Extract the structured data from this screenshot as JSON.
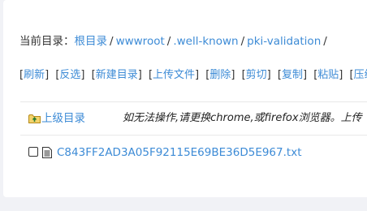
{
  "breadcrumb": {
    "label": "当前目录：",
    "items": [
      {
        "label": "根目录"
      },
      {
        "label": "wwwroot"
      },
      {
        "label": ".well-known"
      },
      {
        "label": "pki-validation"
      }
    ],
    "separator": "/"
  },
  "operations": [
    {
      "label": "刷新"
    },
    {
      "label": "反选"
    },
    {
      "label": "新建目录"
    },
    {
      "label": "上传文件"
    },
    {
      "label": "删除"
    },
    {
      "label": "剪切"
    },
    {
      "label": "复制"
    },
    {
      "label": "粘贴"
    },
    {
      "label": "压缩"
    }
  ],
  "parent_dir": {
    "label": "上级目录",
    "icon": "folder-up-icon"
  },
  "browser_notice": "如无法操作,请更换chrome,或firefox浏览器。上传",
  "files": [
    {
      "name": "C843FF2AD3A05F92115E69BE36D5E967.txt",
      "icon": "text-file-icon",
      "checked": false
    }
  ],
  "colors": {
    "link": "#3d8bd6",
    "page_bg": "#f1f2f6",
    "card_bg": "#ffffff"
  }
}
